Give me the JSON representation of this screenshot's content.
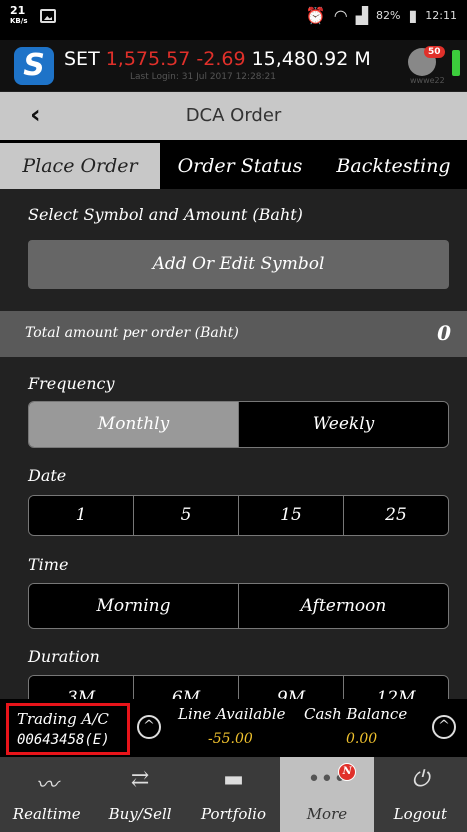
{
  "status_bar": {
    "speed": "21",
    "speed_unit": "KB/s",
    "battery": "82%",
    "time": "12:11"
  },
  "ticker": {
    "index_name": "SET",
    "index_value": "1,575.57",
    "change": "-2.69",
    "volume": "15,480.92 M",
    "last_login": "Last Login: 31 Jul 2017 12:28:21",
    "notification_count": "50",
    "small_text": "wwwe22",
    "colors": {
      "down": "#e0302a",
      "logo": "#1e73c8"
    }
  },
  "header": {
    "back_icon": "chevron-left-icon",
    "title": "DCA Order"
  },
  "tabs": [
    {
      "label": "Place Order",
      "active": true
    },
    {
      "label": "Order Status",
      "active": false
    },
    {
      "label": "Backtesting",
      "active": false
    }
  ],
  "place_order": {
    "select_label": "Select Symbol and Amount (Baht)",
    "add_button": "Add Or Edit Symbol",
    "total_label": "Total amount per order (Baht)",
    "total_value": "0",
    "frequency_label": "Frequency",
    "frequency_options": [
      "Monthly",
      "Weekly"
    ],
    "frequency_selected": "Monthly",
    "date_label": "Date",
    "date_options": [
      "1",
      "5",
      "15",
      "25"
    ],
    "time_label": "Time",
    "time_options": [
      "Morning",
      "Afternoon"
    ],
    "duration_label": "Duration",
    "duration_options": [
      "3M",
      "6M",
      "9M",
      "12M"
    ]
  },
  "account": {
    "label": "Trading A/C",
    "number": "00643458(E)",
    "line_available_label": "Line Available",
    "line_available_value": "-55.00",
    "cash_balance_label": "Cash Balance",
    "cash_balance_value": "0.00"
  },
  "nav": [
    {
      "label": "Realtime",
      "icon": "chart-line-icon"
    },
    {
      "label": "Buy/Sell",
      "icon": "exchange-arrows-icon"
    },
    {
      "label": "Portfolio",
      "icon": "folder-icon"
    },
    {
      "label": "More",
      "icon": "more-dots-icon",
      "badge": "N",
      "active": true
    },
    {
      "label": "Logout",
      "icon": "power-icon"
    }
  ]
}
